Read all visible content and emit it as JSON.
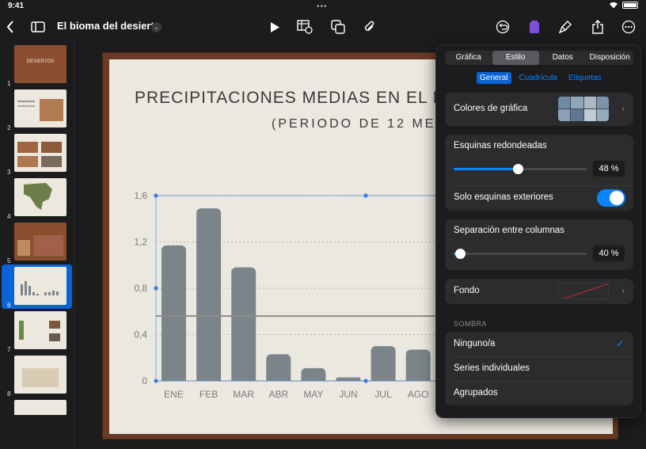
{
  "status": {
    "time": "9:41",
    "dots": "•••"
  },
  "toolbar": {
    "doc_title": "El bioma del desierto",
    "title_chevron": "⌄"
  },
  "navigator": {
    "slides": [
      {
        "num": "1",
        "label": "DESIERTOS"
      },
      {
        "num": "2"
      },
      {
        "num": "3"
      },
      {
        "num": "4"
      },
      {
        "num": "5"
      },
      {
        "num": "6"
      },
      {
        "num": "7"
      },
      {
        "num": "8"
      }
    ]
  },
  "slide": {
    "title": "PRECIPITACIONES MEDIAS EN EL DES",
    "subtitle": "(PERIODO DE 12 MESE"
  },
  "chart_data": {
    "type": "bar",
    "categories": [
      "ENE",
      "FEB",
      "MAR",
      "ABR",
      "MAY",
      "JUN",
      "JUL",
      "AGO"
    ],
    "values": [
      1.17,
      1.49,
      0.98,
      0.23,
      0.11,
      0.03,
      0.3,
      0.27
    ],
    "yticks": [
      "0",
      "0,4",
      "0,8",
      "1,2",
      "1,6"
    ],
    "ylim": [
      0,
      1.6
    ],
    "average_line": 0.56,
    "bar_color": "#7b8489"
  },
  "popover": {
    "tabs": [
      "Gráfica",
      "Estilo",
      "Datos",
      "Disposición"
    ],
    "active_tab": "Estilo",
    "subtabs": [
      "General",
      "Cuadrícula",
      "Etiquetas"
    ],
    "active_subtab": "General",
    "chart_colors_label": "Colores de gráfica",
    "rounded_label": "Esquinas redondeadas",
    "rounded_value": "48 %",
    "rounded_fraction": 0.48,
    "outer_only_label": "Solo esquinas exteriores",
    "gap_label": "Separación entre columnas",
    "gap_value": "40 %",
    "gap_fraction": 0.05,
    "background_label": "Fondo",
    "shadow_header": "SOMBRA",
    "shadow_options": [
      "Ninguno/a",
      "Series individuales",
      "Agrupados"
    ],
    "shadow_selected": "Ninguno/a",
    "accent": "#0a84ff"
  }
}
